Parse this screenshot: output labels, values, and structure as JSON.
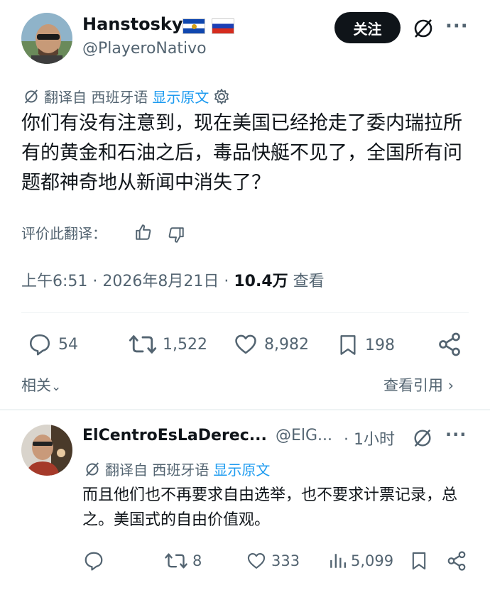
{
  "tweet": {
    "author_name": "Hanstosky",
    "author_handle": "@PlayeroNativo",
    "follow_label": "关注",
    "more_label": "···",
    "translated_from": "翻译自 西班牙语",
    "show_original": "显示原文",
    "text": "你们有没有注意到，现在美国已经抢走了委内瑞拉所有的黄金和石油之后，毒品快艇不见了，全国所有问题都神奇地从新闻中消失了？",
    "rate_translation": "评价此翻译：",
    "time": "上午6:51 · 2026年8月21日 · ",
    "views_count": "10.4万",
    "views_label": " 查看",
    "replies": "54",
    "retweets": "1,522",
    "likes": "8,982",
    "bookmarks": "198",
    "related_label": "相关",
    "view_quotes_label": "查看引用"
  },
  "reply": {
    "author_name": "ElCentroEsLaDerec...",
    "author_handle": "@ElG...",
    "time": "· 1小时",
    "translated_from": "翻译自 西班牙语",
    "show_original": "显示原文",
    "text": "而且他们也不再要求自由选举，也不要求计票记录，总之。美国式的自由价值观。",
    "retweets": "8",
    "likes": "333",
    "views": "5,099"
  },
  "icons": {
    "flags": [
      "el-salvador-flag",
      "russia-flag"
    ],
    "grok": "grok-icon",
    "settings": "gear-icon"
  },
  "colors": {
    "text": "#0f1419",
    "secondary": "#536471",
    "link": "#1d9bf0",
    "button": "#0f1419"
  }
}
